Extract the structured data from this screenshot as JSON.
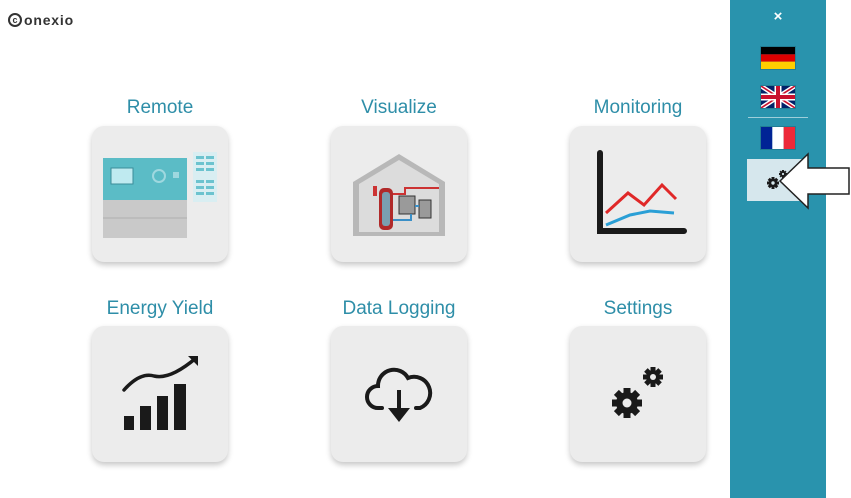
{
  "logo": {
    "mark": "c",
    "text": "onexio"
  },
  "tiles": [
    {
      "label": "Remote",
      "icon": "controller-panel-icon"
    },
    {
      "label": "Visualize",
      "icon": "house-system-icon"
    },
    {
      "label": "Monitoring",
      "icon": "line-chart-icon"
    },
    {
      "label": "Energy Yield",
      "icon": "rising-bars-icon"
    },
    {
      "label": "Data Logging",
      "icon": "cloud-download-icon"
    },
    {
      "label": "Settings",
      "icon": "gears-icon"
    }
  ],
  "sidebar": {
    "close_label": "×",
    "languages": [
      "German",
      "English (UK)",
      "French"
    ],
    "settings_icon": "gears-icon",
    "background": "#2993ad"
  },
  "colors": {
    "accent": "#2e8ea8",
    "tile_bg": "#ececec"
  }
}
